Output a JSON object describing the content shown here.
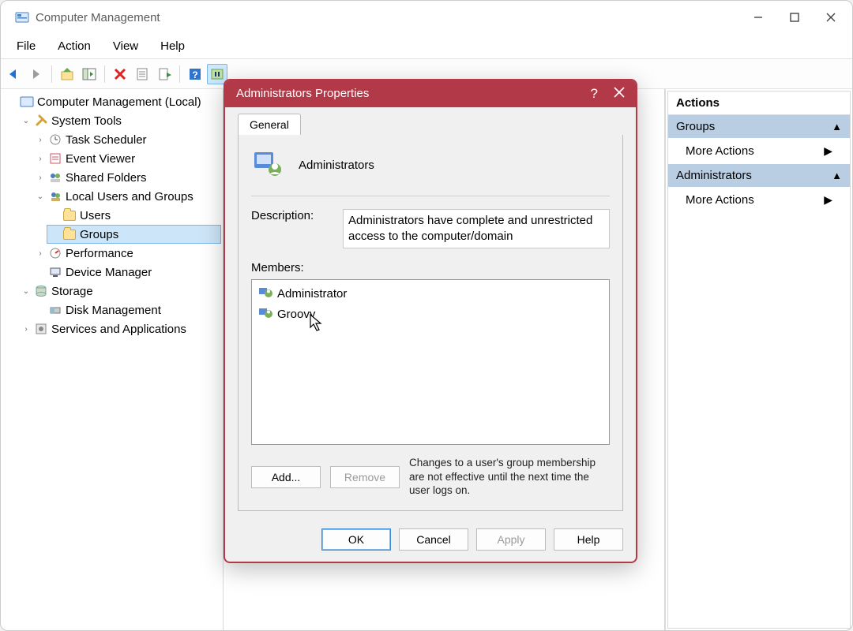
{
  "window": {
    "title": "Computer Management"
  },
  "menu": [
    "File",
    "Action",
    "View",
    "Help"
  ],
  "tree": {
    "root": "Computer Management (Local)",
    "system_tools": "System Tools",
    "task_scheduler": "Task Scheduler",
    "event_viewer": "Event Viewer",
    "shared_folders": "Shared Folders",
    "local_users": "Local Users and Groups",
    "users": "Users",
    "groups": "Groups",
    "performance": "Performance",
    "device_manager": "Device Manager",
    "storage": "Storage",
    "disk_mgmt": "Disk Management",
    "services_apps": "Services and Applications"
  },
  "actions": {
    "pane_title": "Actions",
    "section1": "Groups",
    "item1": "More Actions",
    "section2": "Administrators",
    "item2": "More Actions"
  },
  "dialog": {
    "title": "Administrators Properties",
    "tab_general": "General",
    "group_name": "Administrators",
    "desc_label": "Description:",
    "desc_value": "Administrators have complete and unrestricted access to the computer/domain",
    "members_label": "Members:",
    "members": [
      "Administrator",
      "Groovy"
    ],
    "add_btn": "Add...",
    "remove_btn": "Remove",
    "note": "Changes to a user's group membership are not effective until the next time the user logs on.",
    "ok": "OK",
    "cancel": "Cancel",
    "apply": "Apply",
    "help": "Help"
  }
}
